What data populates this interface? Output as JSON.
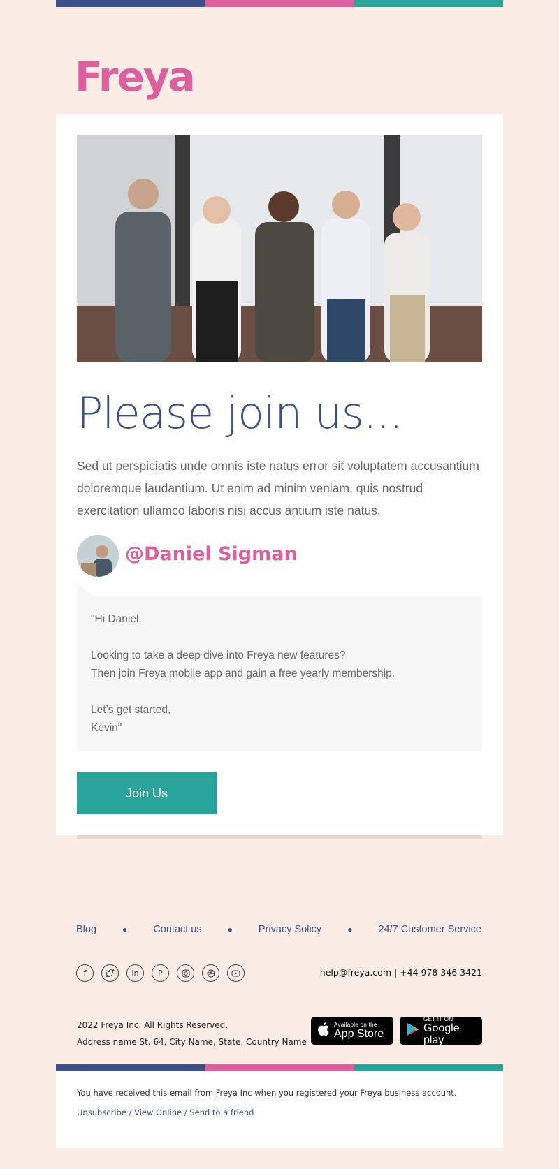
{
  "brand": {
    "name": "Freya",
    "colors": {
      "blue": "#3a5086",
      "pink": "#dc5f9e",
      "teal": "#2aa39b",
      "background": "#fbede5"
    }
  },
  "hero": {
    "image": "team-photo",
    "headline": "Please join us...",
    "intro": "Sed ut perspiciatis unde omnis iste natus error sit voluptatem accusantium doloremque laudantium. Ut enim ad minim veniam, quis nostrud exercitation ullamco laboris nisi accus antium iste natus."
  },
  "author": {
    "handle": "@Daniel Sigman"
  },
  "quote": {
    "lines": [
      "\"Hi Daniel,",
      "",
      "Looking to take a deep dive into Freya new features?",
      "Then join Freya mobile app and gain a free yearly membership.",
      "",
      "Let’s get started,",
      "Kevin\""
    ]
  },
  "cta": {
    "label": "Join Us"
  },
  "footer": {
    "nav": [
      "Blog",
      "Contact us",
      "Privacy Solicy",
      "24/7 Customer Service"
    ],
    "socials": [
      "facebook-icon",
      "twitter-icon",
      "linkedin-icon",
      "pinterest-icon",
      "instagram-icon",
      "dribbble-icon",
      "youtube-icon"
    ],
    "contact": "help@freya.com | +44 978 346 3421",
    "copyright": "2022 Freya Inc. All Rights Reserved.",
    "address": "Address name St. 64, City Name, State, Country Name",
    "appstore": {
      "small": "Available on the",
      "big": "App Store"
    },
    "gplay": {
      "small": "GET IT ON",
      "big": "Google play"
    },
    "notice": "You have received this email from Freya Inc when you registered your Freya business account.",
    "links": "Unsubscribe / View Online / Send to a friend"
  }
}
